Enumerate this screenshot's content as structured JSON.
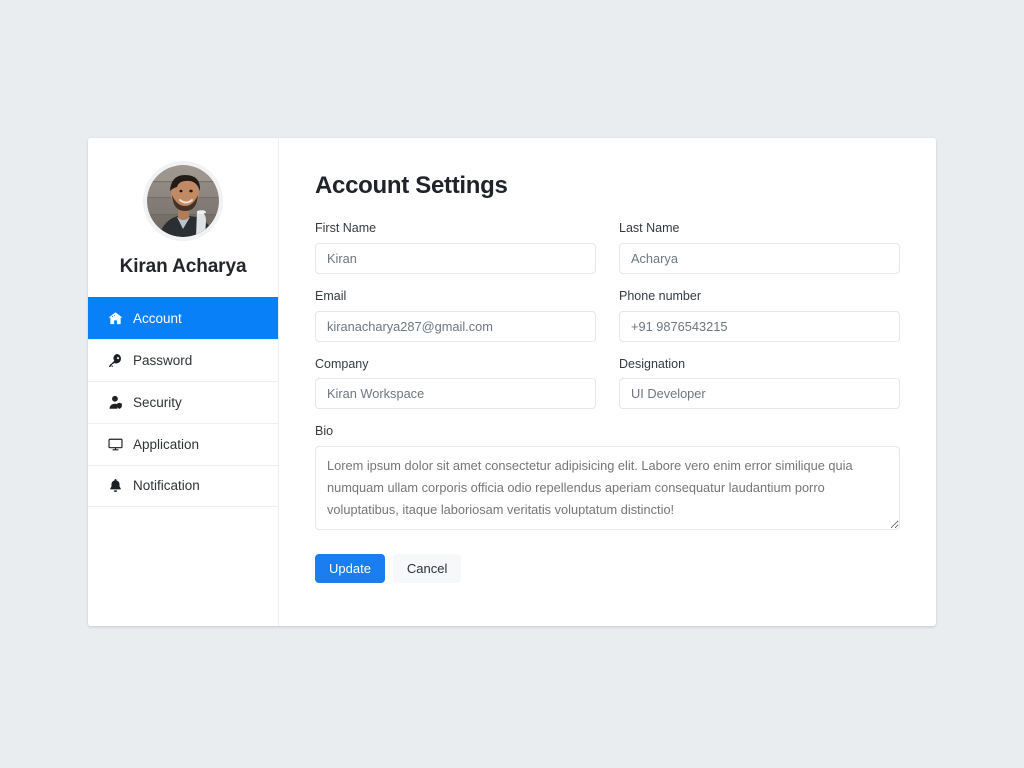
{
  "theme": {
    "page_background": "#e9edf0",
    "card_background": "#ffffff",
    "accent_blue": "#0880f8",
    "primary_button_blue": "#1a7ef0",
    "label_color": "#343a40",
    "input_text_color": "#6e7680"
  },
  "sidebar": {
    "profile": {
      "avatar_alt": "Kiran Acharya profile photo",
      "name": "Kiran Acharya"
    },
    "items": [
      {
        "label": "Account",
        "icon": "home-icon",
        "active": true
      },
      {
        "label": "Password",
        "icon": "key-icon",
        "active": false
      },
      {
        "label": "Security",
        "icon": "user-shield-icon",
        "active": false
      },
      {
        "label": "Application",
        "icon": "desktop-icon",
        "active": false
      },
      {
        "label": "Notification",
        "icon": "bell-icon",
        "active": false
      }
    ]
  },
  "main": {
    "title": "Account Settings",
    "fields": {
      "first_name": {
        "label": "First Name",
        "value": "Kiran",
        "placeholder": "Kiran"
      },
      "last_name": {
        "label": "Last Name",
        "value": "Acharya",
        "placeholder": "Acharya"
      },
      "email": {
        "label": "Email",
        "value": "kiranacharya287@gmail.com",
        "placeholder": "kiranacharya287@gmail.com"
      },
      "phone": {
        "label": "Phone number",
        "value": "+91 9876543215",
        "placeholder": "+91 9876543215"
      },
      "company": {
        "label": "Company",
        "value": "Kiran Workspace",
        "placeholder": "Kiran Workspace"
      },
      "designation": {
        "label": "Designation",
        "value": "UI Developer",
        "placeholder": "UI Developer"
      },
      "bio": {
        "label": "Bio",
        "value": "Lorem ipsum dolor sit amet consectetur adipisicing elit. Labore vero enim error similique quia numquam ullam corporis officia odio repellendus aperiam consequatur laudantium porro voluptatibus, itaque laboriosam veritatis voluptatum distinctio!",
        "placeholder": "Lorem ipsum dolor sit amet consectetur adipisicing elit. Labore vero enim error similique quia numquam ullam corporis officia odio repellendus aperiam consequatur laudantium porro voluptatibus, itaque laboriosam veritatis voluptatum distinctio!"
      }
    },
    "buttons": {
      "update": "Update",
      "cancel": "Cancel"
    }
  }
}
